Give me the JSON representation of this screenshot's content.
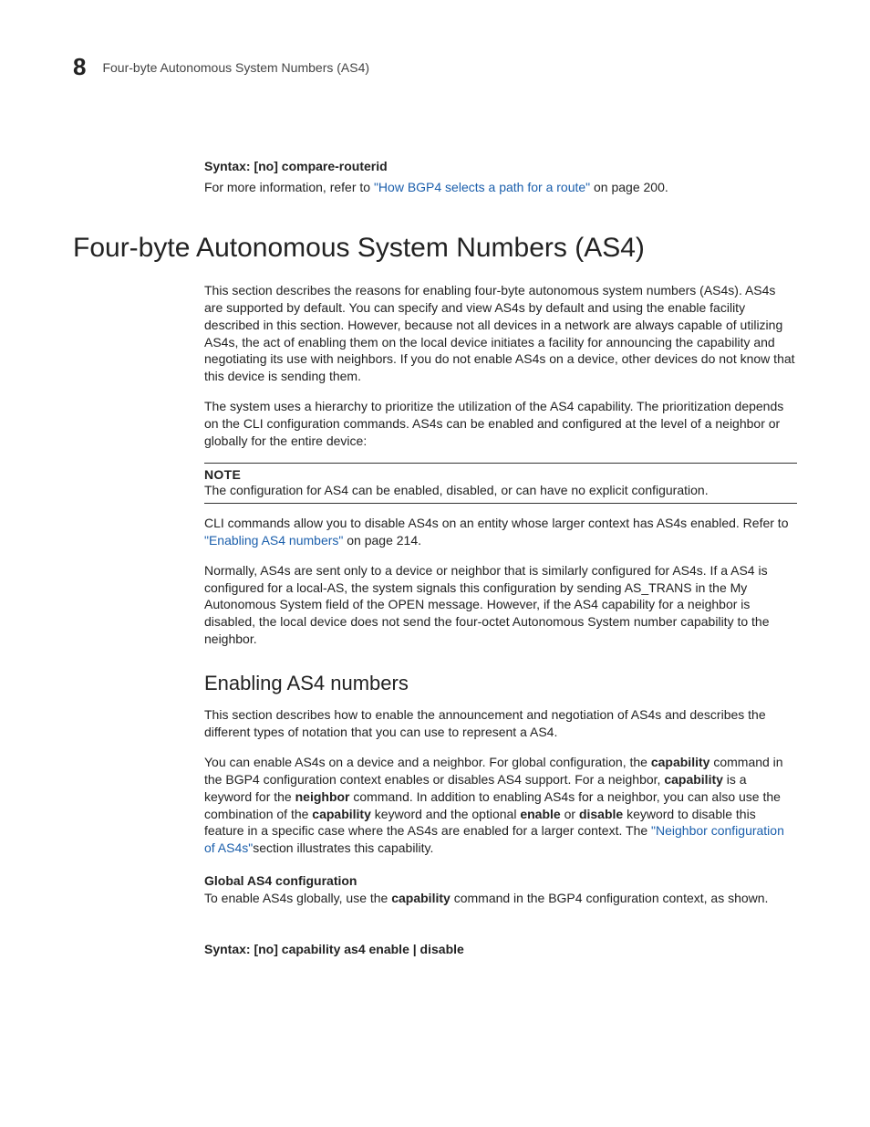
{
  "header": {
    "chapter_number": "8",
    "running_head": "Four-byte Autonomous System Numbers (AS4)"
  },
  "syntax_top": {
    "label": "Syntax:",
    "text": "[no] compare-routerid"
  },
  "para_ref": {
    "pre": "For more information, refer to ",
    "link": "\"How BGP4 selects a path for a route\"",
    "post": " on page 200."
  },
  "section1": {
    "title": "Four-byte Autonomous System Numbers (AS4)",
    "p1": "This section describes the reasons for enabling four-byte autonomous system numbers (AS4s). AS4s are supported by default. You can specify and view AS4s by default and using the enable facility described in this section. However, because not all devices in a network are always capable of utilizing AS4s, the act of enabling them on the local device initiates a facility for announcing the capability and negotiating its use with neighbors. If you do not enable AS4s on a device, other devices do not know that this device is sending them.",
    "p2": "The system uses a hierarchy to prioritize the utilization of the AS4 capability. The prioritization depends on the CLI configuration commands. AS4s can be enabled and configured at the level of a neighbor or globally for the entire device:",
    "note_label": "NOTE",
    "note_text": "The configuration for AS4 can be enabled, disabled, or can have no explicit configuration.",
    "p3_pre": "CLI commands allow you to disable AS4s on an entity whose larger context has AS4s enabled. Refer to ",
    "p3_link": "\"Enabling AS4 numbers\"",
    "p3_post": " on page 214.",
    "p4": "Normally, AS4s are sent only to a device or neighbor that is similarly configured for AS4s. If a AS4 is configured for a local-AS, the system signals this configuration by sending AS_TRANS in the My Autonomous System field of the OPEN message. However, if the AS4 capability for a neighbor is disabled, the local device does not send the four-octet Autonomous System number capability to the neighbor."
  },
  "section2": {
    "title": "Enabling AS4 numbers",
    "p1": "This section describes how to enable the announcement and negotiation of AS4s and describes the different types of notation that you can use to represent a AS4.",
    "p2_seg1": "You can enable AS4s on a device and a neighbor. For global configuration, the ",
    "p2_b1": "capability",
    "p2_seg2": " command in the BGP4 configuration context enables or disables AS4 support. For a neighbor, ",
    "p2_b2": "capability",
    "p2_seg3": " is a keyword for the ",
    "p2_b3": "neighbor",
    "p2_seg4": " command. In addition to enabling AS4s for a neighbor, you can also use the combination of the ",
    "p2_b4": "capability",
    "p2_seg5": " keyword and the optional ",
    "p2_b5": "enable",
    "p2_seg6": " or ",
    "p2_b6": "disable",
    "p2_seg7": " keyword to disable this feature in a specific case where the AS4s are enabled for a larger context. The ",
    "p2_link": "\"Neighbor configuration of AS4s\"",
    "p2_seg8": "section illustrates this capability.",
    "h_global": "Global AS4 configuration",
    "p3_seg1": "To enable AS4s globally, use the ",
    "p3_b1": "capability",
    "p3_seg2": " command in the BGP4 configuration context, as shown.",
    "syntax_label": "Syntax:",
    "syntax_text": "[no] capability as4 enable | disable"
  }
}
